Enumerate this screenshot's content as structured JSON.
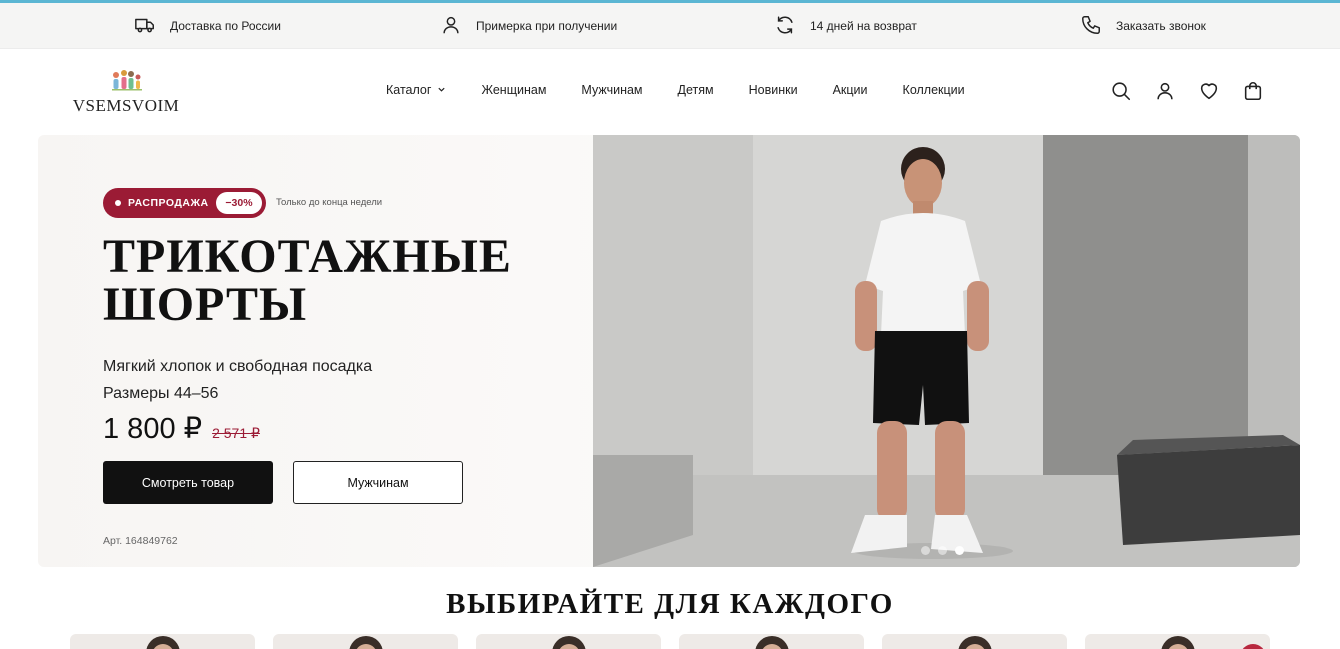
{
  "info_bar": {
    "items": [
      {
        "icon": "truck-icon",
        "label": "Доставка по России"
      },
      {
        "icon": "user-icon",
        "label": "Примерка при получении"
      },
      {
        "icon": "refresh-icon",
        "label": "14 дней на возврат"
      },
      {
        "icon": "phone-icon",
        "label": "Заказать звонок"
      }
    ]
  },
  "header": {
    "logo_text": "VSEMSVOIM",
    "nav": [
      {
        "label": "Каталог"
      },
      {
        "label": "Женщинам"
      },
      {
        "label": "Мужчинам"
      },
      {
        "label": "Детям"
      },
      {
        "label": "Новинки"
      },
      {
        "label": "Акции"
      },
      {
        "label": "Коллекции"
      }
    ],
    "icons": [
      "search-icon",
      "account-icon",
      "heart-icon",
      "cart-icon"
    ]
  },
  "hero": {
    "badge_label": "РАСПРОДАЖА",
    "badge_discount": "−30%",
    "badge_note": "Только до конца недели",
    "title_line1": "ТРИКОТАЖНЫЕ",
    "title_line2": "ШОРТЫ",
    "subtitle_line1": "Мягкий хлопок и свободная посадка",
    "subtitle_line2": "Размеры 44–56",
    "price_current": "1 800 ₽",
    "price_old": "2 571 ₽",
    "primary_button": "Смотреть товар",
    "secondary_button": "Мужчинам",
    "sku": "Арт. 164849762",
    "slides_total": 3,
    "active_slide": 3
  },
  "section": {
    "title": "ВЫБИРАЙТЕ ДЛЯ КАЖДОГО"
  },
  "colors": {
    "accent": "#9b1b35",
    "top_line": "#5bb6d3",
    "dark_button": "#111111"
  }
}
